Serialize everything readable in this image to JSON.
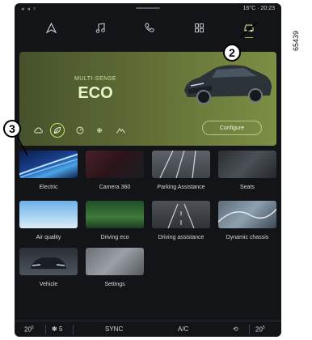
{
  "status": {
    "left_icons": "◂ ◂ ▿",
    "temperature": "16°C",
    "time": "20:23"
  },
  "nav": {
    "items": [
      "nav-icon",
      "music-icon",
      "phone-icon",
      "apps-icon",
      "car-icon"
    ],
    "active": "car-icon"
  },
  "hero": {
    "brand": "MULTI-SENSE",
    "mode": "ECO",
    "configure": "Configure",
    "modes": [
      "cloud-icon",
      "leaf-icon",
      "gauge-icon",
      "gear-icon",
      "mountain-icon"
    ],
    "selected_mode": "leaf-icon"
  },
  "tiles": [
    {
      "label": "Electric"
    },
    {
      "label": "Camera 360"
    },
    {
      "label": "Parking Assistance"
    },
    {
      "label": "Seats"
    },
    {
      "label": "Air quality"
    },
    {
      "label": "Driving eco"
    },
    {
      "label": "Driving assistance"
    },
    {
      "label": "Dynamic chassis"
    },
    {
      "label": "Vehicle"
    },
    {
      "label": "Settings"
    }
  ],
  "bottom": {
    "left_temp": "20",
    "left_temp_unit": "5",
    "fan": "5",
    "sync": "SYNC",
    "ac": "A/C",
    "right_temp": "20",
    "right_temp_unit": "5"
  },
  "callouts": {
    "two": "2",
    "three": "3"
  },
  "reference": "65439"
}
